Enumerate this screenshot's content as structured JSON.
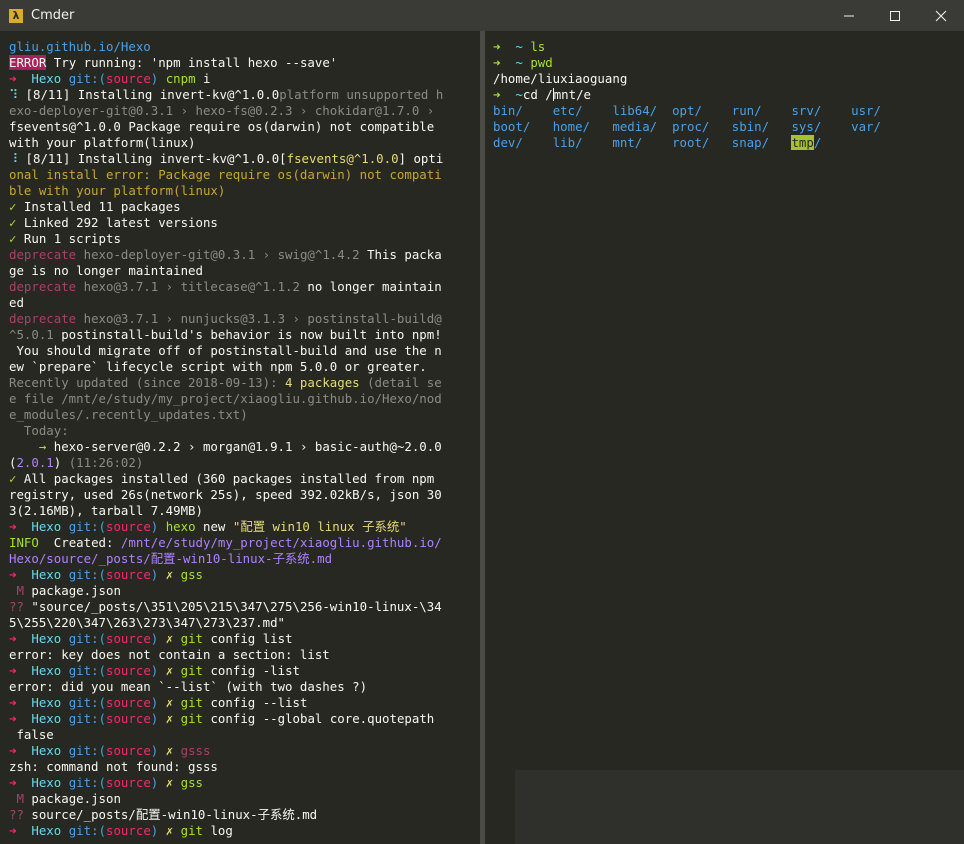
{
  "window": {
    "title": "Cmder",
    "app_icon": "λ"
  },
  "left_pane": [
    [
      {
        "t": "gliu.github.io/Hexo",
        "c": "c-blue"
      }
    ],
    [
      {
        "t": "ERROR",
        "c": "c-err"
      },
      {
        "t": " Try running: 'npm install hexo --save'",
        "c": "c-def"
      }
    ],
    [
      {
        "t": "➜  ",
        "c": "c-arrow"
      },
      {
        "t": "Hexo ",
        "c": "c-cyan"
      },
      {
        "t": "git:(",
        "c": "c-blue"
      },
      {
        "t": "source",
        "c": "c-pink"
      },
      {
        "t": ") ",
        "c": "c-blue"
      },
      {
        "t": "cnpm",
        "c": "c-green"
      },
      {
        "t": " i",
        "c": "c-def"
      }
    ],
    [
      {
        "t": "⠹ ",
        "c": "c-cyan"
      },
      {
        "t": "[8/11] Installing invert-kv@^1.0.0",
        "c": "c-def"
      },
      {
        "t": "platform unsupported h",
        "c": "c-gray"
      }
    ],
    [
      {
        "t": "exo-deployer-git@0.3.1 › hexo-fs@0.2.3 › chokidar@1.7.0 › ",
        "c": "c-gray"
      }
    ],
    [
      {
        "t": "fsevents@^1.0.0 Package require os(darwin) not compatible",
        "c": "c-def"
      }
    ],
    [
      {
        "t": "with your platform(linux)",
        "c": "c-def"
      }
    ],
    [
      {
        "t": "⠸ ",
        "c": "c-cyan"
      },
      {
        "t": "[8/11] Installing invert-kv@^1.0.0[",
        "c": "c-def"
      },
      {
        "t": "fsevents@^1.0.0",
        "c": "c-yellow"
      },
      {
        "t": "] opti",
        "c": "c-def"
      }
    ],
    [
      {
        "t": "onal install error: Package require os(darwin) not compati",
        "c": "c-orange"
      }
    ],
    [
      {
        "t": "ble with your platform(linux)",
        "c": "c-orange"
      }
    ],
    [
      {
        "t": "✓ ",
        "c": "c-green"
      },
      {
        "t": "Installed 11 packages",
        "c": "c-def"
      }
    ],
    [
      {
        "t": "✓ ",
        "c": "c-green"
      },
      {
        "t": "Linked 292 latest versions",
        "c": "c-def"
      }
    ],
    [
      {
        "t": "✓ ",
        "c": "c-green"
      },
      {
        "t": "Run 1 scripts",
        "c": "c-def"
      }
    ],
    [
      {
        "t": "deprecate ",
        "c": "c-red"
      },
      {
        "t": "hexo-deployer-git@0.3.1 › swig@^1.4.2 ",
        "c": "c-gray"
      },
      {
        "t": "This packa",
        "c": "c-def"
      }
    ],
    [
      {
        "t": "ge is no longer maintained",
        "c": "c-def"
      }
    ],
    [
      {
        "t": "deprecate ",
        "c": "c-red"
      },
      {
        "t": "hexo@3.7.1 › titlecase@^1.1.2 ",
        "c": "c-gray"
      },
      {
        "t": "no longer maintain",
        "c": "c-def"
      }
    ],
    [
      {
        "t": "ed",
        "c": "c-def"
      }
    ],
    [
      {
        "t": "deprecate ",
        "c": "c-red"
      },
      {
        "t": "hexo@3.7.1 › nunjucks@3.1.3 › postinstall-build@",
        "c": "c-gray"
      }
    ],
    [
      {
        "t": "^5.0.1 ",
        "c": "c-gray"
      },
      {
        "t": "postinstall-build's behavior is now built into npm!",
        "c": "c-def"
      }
    ],
    [
      {
        "t": " You should migrate off of postinstall-build and use the n",
        "c": "c-def"
      }
    ],
    [
      {
        "t": "ew `prepare` lifecycle script with npm 5.0.0 or greater.",
        "c": "c-def"
      }
    ],
    [
      {
        "t": "Recently updated (since 2018-09-13): ",
        "c": "c-gray"
      },
      {
        "t": "4 packages",
        "c": "c-yellow"
      },
      {
        "t": " (detail se",
        "c": "c-gray"
      }
    ],
    [
      {
        "t": "e file /mnt/e/study/my_project/xiaogliu.github.io/Hexo/nod",
        "c": "c-gray"
      }
    ],
    [
      {
        "t": "e_modules/.recently_updates.txt)",
        "c": "c-gray"
      }
    ],
    [
      {
        "t": "  Today:",
        "c": "c-gray"
      }
    ],
    [
      {
        "t": "    → ",
        "c": "c-green"
      },
      {
        "t": "hexo-server@0.2.2 › morgan@1.9.1 › basic-auth@~2.0.0",
        "c": "c-def"
      }
    ],
    [
      {
        "t": "(",
        "c": "c-def"
      },
      {
        "t": "2.0.1",
        "c": "c-purple"
      },
      {
        "t": ") ",
        "c": "c-def"
      },
      {
        "t": "(11:26:02)",
        "c": "c-gray"
      }
    ],
    [
      {
        "t": "✓ ",
        "c": "c-green"
      },
      {
        "t": "All packages installed (360 packages installed from npm",
        "c": "c-def"
      }
    ],
    [
      {
        "t": "registry, used 26s(network 25s), speed 392.02kB/s, json 30",
        "c": "c-def"
      }
    ],
    [
      {
        "t": "3(2.16MB), tarball 7.49MB)",
        "c": "c-def"
      }
    ],
    [
      {
        "t": "➜  ",
        "c": "c-arrow"
      },
      {
        "t": "Hexo ",
        "c": "c-cyan"
      },
      {
        "t": "git:(",
        "c": "c-blue"
      },
      {
        "t": "source",
        "c": "c-pink"
      },
      {
        "t": ") ",
        "c": "c-blue"
      },
      {
        "t": "hexo",
        "c": "c-green"
      },
      {
        "t": " new ",
        "c": "c-def"
      },
      {
        "t": "\"配置 win10 linux 子系统\"",
        "c": "c-yellow"
      }
    ],
    [
      {
        "t": "INFO ",
        "c": "c-green"
      },
      {
        "t": " Created: ",
        "c": "c-def"
      },
      {
        "t": "/mnt/e/study/my_project/xiaogliu.github.io/",
        "c": "c-purple"
      }
    ],
    [
      {
        "t": "Hexo/source/_posts/配置-win10-linux-子系统.md",
        "c": "c-purple"
      }
    ],
    [
      {
        "t": "➜  ",
        "c": "c-arrow"
      },
      {
        "t": "Hexo ",
        "c": "c-cyan"
      },
      {
        "t": "git:(",
        "c": "c-blue"
      },
      {
        "t": "source",
        "c": "c-pink"
      },
      {
        "t": ") ",
        "c": "c-blue"
      },
      {
        "t": "✗ ",
        "c": "c-yellow"
      },
      {
        "t": "gss",
        "c": "c-green"
      }
    ],
    [
      {
        "t": " M ",
        "c": "c-red"
      },
      {
        "t": "package.json",
        "c": "c-def"
      }
    ],
    [
      {
        "t": "?? ",
        "c": "c-red"
      },
      {
        "t": "\"source/_posts/\\351\\205\\215\\347\\275\\256-win10-linux-\\34",
        "c": "c-def"
      }
    ],
    [
      {
        "t": "5\\255\\220\\347\\263\\273\\347\\273\\237.md\"",
        "c": "c-def"
      }
    ],
    [
      {
        "t": "➜  ",
        "c": "c-arrow"
      },
      {
        "t": "Hexo ",
        "c": "c-cyan"
      },
      {
        "t": "git:(",
        "c": "c-blue"
      },
      {
        "t": "source",
        "c": "c-pink"
      },
      {
        "t": ") ",
        "c": "c-blue"
      },
      {
        "t": "✗ ",
        "c": "c-yellow"
      },
      {
        "t": "git",
        "c": "c-green"
      },
      {
        "t": " config list",
        "c": "c-def"
      }
    ],
    [
      {
        "t": "error: key does not contain a section: list",
        "c": "c-def"
      }
    ],
    [
      {
        "t": "➜  ",
        "c": "c-arrow"
      },
      {
        "t": "Hexo ",
        "c": "c-cyan"
      },
      {
        "t": "git:(",
        "c": "c-blue"
      },
      {
        "t": "source",
        "c": "c-pink"
      },
      {
        "t": ") ",
        "c": "c-blue"
      },
      {
        "t": "✗ ",
        "c": "c-yellow"
      },
      {
        "t": "git",
        "c": "c-green"
      },
      {
        "t": " config -list",
        "c": "c-def"
      }
    ],
    [
      {
        "t": "error: did you mean `--list` (with two dashes ?)",
        "c": "c-def"
      }
    ],
    [
      {
        "t": "➜  ",
        "c": "c-arrow"
      },
      {
        "t": "Hexo ",
        "c": "c-cyan"
      },
      {
        "t": "git:(",
        "c": "c-blue"
      },
      {
        "t": "source",
        "c": "c-pink"
      },
      {
        "t": ") ",
        "c": "c-blue"
      },
      {
        "t": "✗ ",
        "c": "c-yellow"
      },
      {
        "t": "git",
        "c": "c-green"
      },
      {
        "t": " config --list",
        "c": "c-def"
      }
    ],
    [
      {
        "t": "➜  ",
        "c": "c-arrow"
      },
      {
        "t": "Hexo ",
        "c": "c-cyan"
      },
      {
        "t": "git:(",
        "c": "c-blue"
      },
      {
        "t": "source",
        "c": "c-pink"
      },
      {
        "t": ") ",
        "c": "c-blue"
      },
      {
        "t": "✗ ",
        "c": "c-yellow"
      },
      {
        "t": "git",
        "c": "c-green"
      },
      {
        "t": " config --global core.quotepath",
        "c": "c-def"
      }
    ],
    [
      {
        "t": " false",
        "c": "c-def"
      }
    ],
    [
      {
        "t": "➜  ",
        "c": "c-arrow"
      },
      {
        "t": "Hexo ",
        "c": "c-cyan"
      },
      {
        "t": "git:(",
        "c": "c-blue"
      },
      {
        "t": "source",
        "c": "c-pink"
      },
      {
        "t": ") ",
        "c": "c-blue"
      },
      {
        "t": "✗ ",
        "c": "c-yellow"
      },
      {
        "t": "gsss",
        "c": "c-red"
      }
    ],
    [
      {
        "t": "zsh: command not found: gsss",
        "c": "c-def"
      }
    ],
    [
      {
        "t": "➜  ",
        "c": "c-arrow"
      },
      {
        "t": "Hexo ",
        "c": "c-cyan"
      },
      {
        "t": "git:(",
        "c": "c-blue"
      },
      {
        "t": "source",
        "c": "c-pink"
      },
      {
        "t": ") ",
        "c": "c-blue"
      },
      {
        "t": "✗ ",
        "c": "c-yellow"
      },
      {
        "t": "gss",
        "c": "c-green"
      }
    ],
    [
      {
        "t": " M ",
        "c": "c-red"
      },
      {
        "t": "package.json",
        "c": "c-def"
      }
    ],
    [
      {
        "t": "?? ",
        "c": "c-red"
      },
      {
        "t": "source/_posts/配置-win10-linux-子系统.md",
        "c": "c-def"
      }
    ],
    [
      {
        "t": "➜  ",
        "c": "c-arrow"
      },
      {
        "t": "Hexo ",
        "c": "c-cyan"
      },
      {
        "t": "git:(",
        "c": "c-blue"
      },
      {
        "t": "source",
        "c": "c-pink"
      },
      {
        "t": ") ",
        "c": "c-blue"
      },
      {
        "t": "✗ ",
        "c": "c-yellow"
      },
      {
        "t": "git",
        "c": "c-green"
      },
      {
        "t": " log",
        "c": "c-def"
      }
    ]
  ],
  "right_pane": [
    [
      {
        "t": "➜  ",
        "c": "c-garrow"
      },
      {
        "t": "~ ",
        "c": "c-cyan"
      },
      {
        "t": "ls",
        "c": "c-green"
      }
    ],
    [
      {
        "t": "➜  ",
        "c": "c-garrow"
      },
      {
        "t": "~ ",
        "c": "c-cyan"
      },
      {
        "t": "pwd",
        "c": "c-green"
      }
    ],
    [
      {
        "t": "/home/liuxiaoguang",
        "c": "c-def"
      }
    ],
    [
      {
        "t": "➜  ",
        "c": "c-garrow"
      },
      {
        "t": "~",
        "c": "c-cyan"
      },
      {
        "t": "cd /",
        "c": "c-def"
      },
      {
        "t": "|",
        "c": "cursor"
      },
      {
        "t": "mnt/e",
        "c": "c-def"
      }
    ],
    [
      {
        "t": "bin/    ",
        "c": "c-blue"
      },
      {
        "t": "etc/    ",
        "c": "c-blue"
      },
      {
        "t": "lib64/  ",
        "c": "c-blue"
      },
      {
        "t": "opt/    ",
        "c": "c-blue"
      },
      {
        "t": "run/    ",
        "c": "c-blue"
      },
      {
        "t": "srv/    ",
        "c": "c-blue"
      },
      {
        "t": "usr/",
        "c": "c-blue"
      }
    ],
    [
      {
        "t": "boot/   ",
        "c": "c-blue"
      },
      {
        "t": "home/   ",
        "c": "c-blue"
      },
      {
        "t": "media/  ",
        "c": "c-blue"
      },
      {
        "t": "proc/   ",
        "c": "c-blue"
      },
      {
        "t": "sbin/   ",
        "c": "c-blue"
      },
      {
        "t": "sys/    ",
        "c": "c-blue"
      },
      {
        "t": "var/",
        "c": "c-blue"
      }
    ],
    [
      {
        "t": "dev/    ",
        "c": "c-blue"
      },
      {
        "t": "lib/    ",
        "c": "c-blue"
      },
      {
        "t": "mnt/    ",
        "c": "c-blue"
      },
      {
        "t": "root/   ",
        "c": "c-blue"
      },
      {
        "t": "snap/   ",
        "c": "c-blue"
      },
      {
        "t": "tmp",
        "c": "c-tmp"
      },
      {
        "t": "/",
        "c": "c-blue"
      }
    ]
  ]
}
